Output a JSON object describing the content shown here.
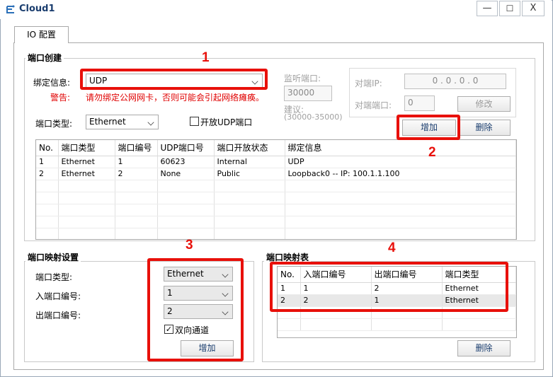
{
  "window": {
    "title": "Cloud1",
    "controls": {
      "minimize": "—",
      "maximize": "☐",
      "close": "X"
    }
  },
  "tabs": [
    {
      "label": "IO 配置"
    }
  ],
  "port_creation": {
    "title": "端口创建",
    "bind_label": "绑定信息:",
    "bind_value": "UDP",
    "warning_label": "警告:",
    "warning_text": "请勿绑定公网网卡，否则可能会引起网络瘫痪。",
    "port_type_label": "端口类型:",
    "port_type_value": "Ethernet",
    "open_udp_label": "开放UDP端口",
    "listen_port_label": "监听端口:",
    "listen_port_value": "30000",
    "suggest_label": "建议:",
    "suggest_range": "(30000-35000)",
    "peer_ip_label": "对端IP:",
    "peer_ip_value": "0 . 0 . 0 . 0",
    "peer_port_label": "对端端口:",
    "peer_port_value": "0",
    "modify_button": "修改",
    "add_button": "增加",
    "delete_button": "删除",
    "table": {
      "headers": [
        "No.",
        "端口类型",
        "端口编号",
        "UDP端口号",
        "端口开放状态",
        "绑定信息"
      ],
      "rows": [
        [
          "1",
          "Ethernet",
          "1",
          "60623",
          "Internal",
          "UDP"
        ],
        [
          "2",
          "Ethernet",
          "2",
          "None",
          "Public",
          "Loopback0 -- IP: 100.1.1.100"
        ]
      ]
    }
  },
  "mapping_settings": {
    "title": "端口映射设置",
    "port_type_label": "端口类型:",
    "port_type_value": "Ethernet",
    "in_port_label": "入端口编号:",
    "in_port_value": "1",
    "out_port_label": "出端口编号:",
    "out_port_value": "2",
    "bidirectional_label": "双向通道",
    "bidirectional_check": "✓",
    "add_button": "增加"
  },
  "mapping_table": {
    "title": "端口映射表",
    "headers": [
      "No.",
      "入端口编号",
      "出端口编号",
      "端口类型"
    ],
    "rows": [
      [
        "1",
        "1",
        "2",
        "Ethernet"
      ],
      [
        "2",
        "2",
        "1",
        "Ethernet"
      ]
    ],
    "delete_button": "删除"
  },
  "annotations": [
    "1",
    "2",
    "3",
    "4"
  ],
  "colors": {
    "highlight_red": "#e8100a",
    "warning_red": "#e00000",
    "title_blue": "#1a3d6e"
  }
}
